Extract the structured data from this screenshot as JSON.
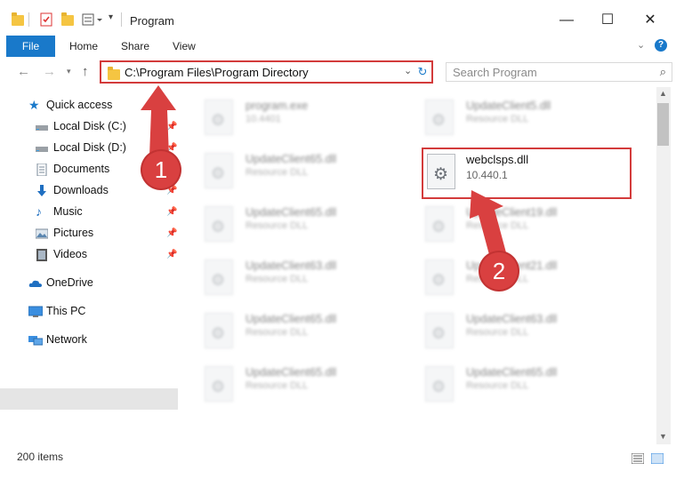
{
  "window": {
    "title": "Program",
    "controls": {
      "minimize": "—",
      "maximize": "☐",
      "close": "✕"
    }
  },
  "ribbon": {
    "tabs": [
      "File",
      "Home",
      "Share",
      "View"
    ],
    "help": "?"
  },
  "address": {
    "path": "C:\\Program Files\\Program Directory",
    "search_placeholder": "Search Program"
  },
  "sidebar": {
    "items": [
      {
        "label": "Quick access",
        "icon": "star-icon"
      },
      {
        "label": "Local Disk (C:)",
        "icon": "drive-icon",
        "pinned": true
      },
      {
        "label": "Local Disk (D:)",
        "icon": "drive-icon",
        "pinned": true
      },
      {
        "label": "Documents",
        "icon": "documents-icon",
        "pinned": true
      },
      {
        "label": "Downloads",
        "icon": "download-icon",
        "pinned": true
      },
      {
        "label": "Music",
        "icon": "music-icon",
        "pinned": true
      },
      {
        "label": "Pictures",
        "icon": "pictures-icon",
        "pinned": true
      },
      {
        "label": "Videos",
        "icon": "video-icon",
        "pinned": true
      },
      {
        "label": "OneDrive",
        "icon": "cloud-icon"
      },
      {
        "label": "This PC",
        "icon": "computer-icon",
        "selected": true
      },
      {
        "label": "Network",
        "icon": "network-icon"
      }
    ]
  },
  "files": {
    "left": [
      {
        "name": "program.exe",
        "sub": "10.4401"
      },
      {
        "name": "UpdateClient65.dll",
        "sub": "Resource DLL"
      },
      {
        "name": "UpdateClient65.dll",
        "sub": "Resource DLL"
      },
      {
        "name": "UpdateClient63.dll",
        "sub": "Resource DLL"
      },
      {
        "name": "UpdateClient65.dll",
        "sub": "Resource DLL"
      },
      {
        "name": "UpdateClient65.dll",
        "sub": "Resource DLL"
      }
    ],
    "right": [
      {
        "name": "UpdateClient5.dll",
        "sub": "Resource DLL"
      },
      {
        "name": "UpdateClient19.dll",
        "sub": "Resource DLL"
      },
      {
        "name": "UpdateClient21.dll",
        "sub": "Resource DLL"
      },
      {
        "name": "UpdateClient63.dll",
        "sub": "Resource DLL"
      },
      {
        "name": "UpdateClient65.dll",
        "sub": "Resource DLL"
      }
    ],
    "highlighted": {
      "name": "webclsps.dll",
      "version": "10.440.1"
    }
  },
  "status": {
    "count": "200 items"
  },
  "annotations": {
    "step1": "1",
    "step2": "2"
  },
  "colors": {
    "accent": "#1979ca",
    "highlight": "#d33b3b",
    "badge": "#d94040"
  }
}
